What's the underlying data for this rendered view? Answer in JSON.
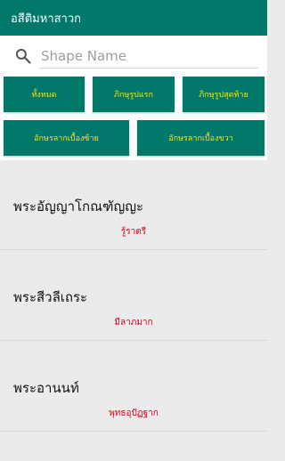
{
  "appbar": {
    "title": "อสีติมหาสาวก"
  },
  "search": {
    "placeholder": "Shape Name",
    "value": "",
    "icon": "search-icon"
  },
  "filters": {
    "all": "ทั้งหมด",
    "first_monks": "ภิกษุรูปแรก",
    "last_monks": "ภิกษุรูปสุดท้าย",
    "left_chars": "อักษรลากเบื้องซ้าย",
    "right_chars": "อักษรลากเบื้องขวา"
  },
  "items": [
    {
      "name": "พระอัญญาโกณฑัญญะ",
      "sub": "รู้ราตรี"
    },
    {
      "name": "พระสีวลีเถระ",
      "sub": "มีลาภมาก"
    },
    {
      "name": "พระอานนท์",
      "sub": "พุทธอุปัฏฐาก"
    }
  ],
  "colors": {
    "primary": "#00796b",
    "button_text": "#ffe600",
    "subtitle": "#e0001b",
    "list_background": "#ebebeb"
  }
}
